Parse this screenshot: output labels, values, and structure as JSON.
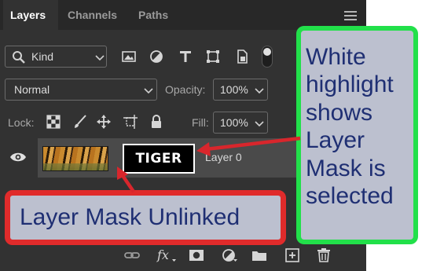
{
  "tabs": [
    {
      "label": "Layers",
      "active": true
    },
    {
      "label": "Channels",
      "active": false
    },
    {
      "label": "Paths",
      "active": false
    }
  ],
  "filter": {
    "kind_label": "Kind",
    "icons": [
      "image-filter-icon",
      "adjustment-filter-icon",
      "type-filter-icon",
      "shape-filter-icon",
      "smart-object-filter-icon",
      "filter-toggle-icon"
    ]
  },
  "blend_mode": "Normal",
  "opacity": {
    "label": "Opacity:",
    "value": "100%"
  },
  "lock": {
    "label": "Lock:",
    "icons": [
      "lock-transparent-pixels-icon",
      "lock-image-pixels-icon",
      "lock-position-icon",
      "lock-artboard-icon",
      "lock-all-icon"
    ]
  },
  "fill": {
    "label": "Fill:",
    "value": "100%"
  },
  "layer": {
    "name": "Layer 0",
    "visible": true,
    "mask_text": "TIGER",
    "mask_selected": true,
    "mask_linked": false
  },
  "bottom_icons": [
    "link-layers-icon",
    "fx-icon",
    "add-mask-icon",
    "adjustment-layer-icon",
    "new-group-icon",
    "new-layer-icon",
    "delete-icon"
  ],
  "callouts": {
    "unlinked": "Layer Mask Unlinked",
    "selected": "White highlight shows Layer Mask is selected"
  },
  "colors": {
    "panel_bg": "#323232",
    "red_callout_border": "#e02b2b",
    "green_callout_border": "#22e04a",
    "callout_text": "#1f2f73"
  }
}
